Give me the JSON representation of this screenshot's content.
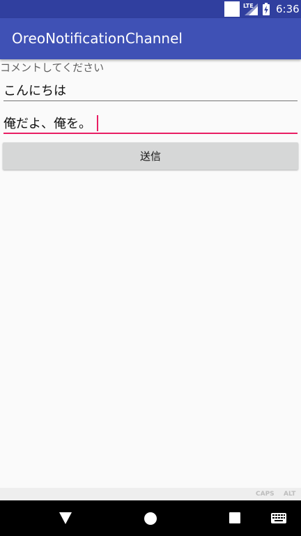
{
  "status_bar": {
    "network_label": "LTE",
    "time": "6:36"
  },
  "app_bar": {
    "title": "OreoNotificationChannel"
  },
  "form": {
    "comment_label": "コメントしてください",
    "field_1_value": "こんにちは",
    "field_2_value": "俺だよ、俺を。",
    "send_label": "送信"
  },
  "keyboard": {
    "caps_label": "CAPS",
    "alt_label": "ALT"
  },
  "nav": {
    "icons": [
      "back-icon",
      "home-icon",
      "recents-icon",
      "keyboard-icon"
    ]
  },
  "colors": {
    "primary": "#3f51b5",
    "primary_dark": "#303f9f",
    "accent": "#e91e63",
    "background": "#fafafa",
    "button": "#d6d7d7"
  }
}
